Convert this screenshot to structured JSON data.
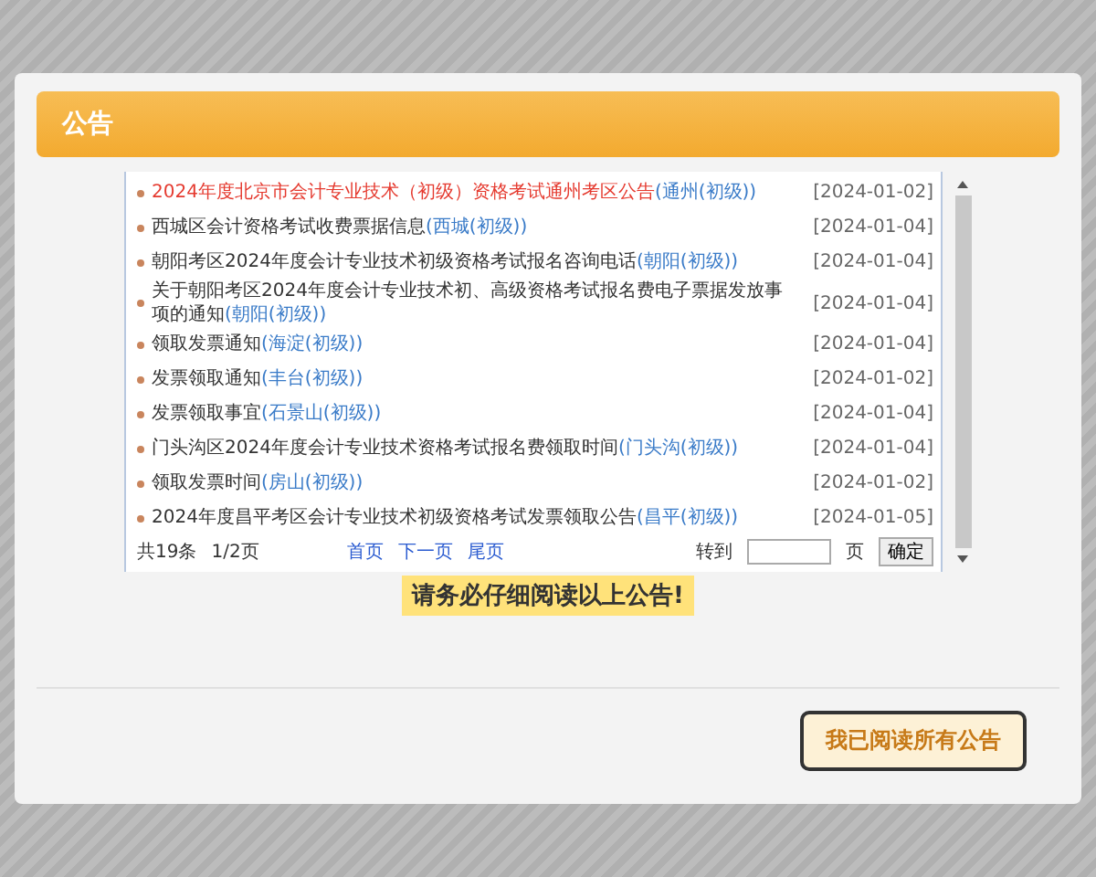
{
  "dialog": {
    "title": "公告"
  },
  "notices": [
    {
      "title": "2024年度北京市会计专业技术（初级）资格考试通州考区公告",
      "tag": "(通州(初级))",
      "date": "[2024-01-02]",
      "highlighted": true
    },
    {
      "title": "西城区会计资格考试收费票据信息",
      "tag": "(西城(初级))",
      "date": "[2024-01-04]",
      "highlighted": false
    },
    {
      "title": "朝阳考区2024年度会计专业技术初级资格考试报名咨询电话",
      "tag": "(朝阳(初级))",
      "date": "[2024-01-04]",
      "highlighted": false
    },
    {
      "title": "关于朝阳考区2024年度会计专业技术初、高级资格考试报名费电子票据发放事项的通知",
      "tag": "(朝阳(初级))",
      "date": "[2024-01-04]",
      "highlighted": false
    },
    {
      "title": "领取发票通知",
      "tag": "(海淀(初级))",
      "date": "[2024-01-04]",
      "highlighted": false
    },
    {
      "title": "发票领取通知",
      "tag": "(丰台(初级))",
      "date": "[2024-01-02]",
      "highlighted": false
    },
    {
      "title": "发票领取事宜",
      "tag": "(石景山(初级))",
      "date": "[2024-01-04]",
      "highlighted": false
    },
    {
      "title": "门头沟区2024年度会计专业技术资格考试报名费领取时间",
      "tag": "(门头沟(初级))",
      "date": "[2024-01-04]",
      "highlighted": false
    },
    {
      "title": "领取发票时间",
      "tag": "(房山(初级))",
      "date": "[2024-01-02]",
      "highlighted": false
    },
    {
      "title": "2024年度昌平考区会计专业技术初级资格考试发票领取公告",
      "tag": "(昌平(初级))",
      "date": "[2024-01-05]",
      "highlighted": false
    }
  ],
  "pagination": {
    "total": "共19条",
    "page": "1/2页",
    "links": [
      "首页",
      "下一页",
      "尾页"
    ],
    "goto_label": "转到",
    "page_unit": "页",
    "confirm": "确定"
  },
  "banner": "请务必仔细阅读以上公告!",
  "confirm_button": "我已阅读所有公告"
}
